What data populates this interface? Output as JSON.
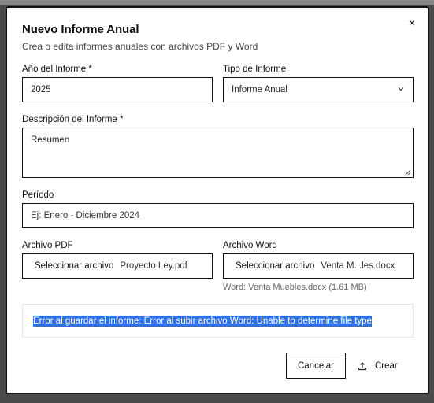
{
  "dialog": {
    "title": "Nuevo Informe Anual",
    "subtitle": "Crea o edita informes anuales con archivos PDF y Word",
    "close_symbol": "×"
  },
  "fields": {
    "year_label": "Año del Informe *",
    "year_value": "2025",
    "type_label": "Tipo de Informe",
    "type_value": "Informe Anual",
    "description_label": "Descripción del Informe *",
    "description_value": "Resumen",
    "period_label": "Período",
    "period_placeholder": "Ej: Enero - Diciembre 2024",
    "pdf_label": "Archivo PDF",
    "pdf_button": "Seleccionar archivo",
    "pdf_filename": "Proyecto Ley.pdf",
    "word_label": "Archivo Word",
    "word_button": "Seleccionar archivo",
    "word_filename": "Venta M...les.docx",
    "word_hint": "Word: Venta Muebles.docx (1.61 MB)"
  },
  "error": {
    "message": "Error al guardar el informe: Error al subir archivo Word: Unable to determine file type"
  },
  "footer": {
    "cancel_label": "Cancelar",
    "create_label": "Crear"
  },
  "icons": {
    "close": "close-icon",
    "chevron": "chevron-down-icon",
    "upload": "upload-icon"
  }
}
